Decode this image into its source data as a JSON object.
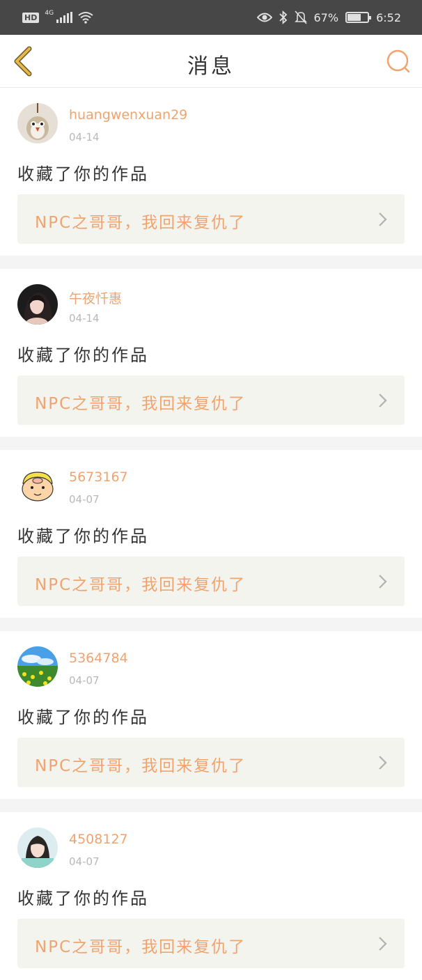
{
  "status_bar": {
    "hd": "HD",
    "network": "4G",
    "battery_text": "67%",
    "battery_level": 0.67,
    "time": "6:52"
  },
  "nav": {
    "title": "消息",
    "back_icon": "chevron-left-icon",
    "search_icon": "search-icon"
  },
  "colors": {
    "accent": "#f0a36e",
    "back_icon": "#e8b84a",
    "status_bg": "#474747"
  },
  "messages": [
    {
      "username": "huangwenxuan29",
      "date": "04-14",
      "action": "收藏了你的作品",
      "work_title": "NPC之哥哥，我回来复仇了",
      "avatar": "owl-avatar"
    },
    {
      "username": "午夜忏惠",
      "date": "04-14",
      "action": "收藏了你的作品",
      "work_title": "NPC之哥哥，我回来复仇了",
      "avatar": "portrait-avatar"
    },
    {
      "username": "5673167",
      "date": "04-07",
      "action": "收藏了你的作品",
      "work_title": "NPC之哥哥，我回来复仇了",
      "avatar": "pig-avatar"
    },
    {
      "username": "5364784",
      "date": "04-07",
      "action": "收藏了你的作品",
      "work_title": "NPC之哥哥，我回来复仇了",
      "avatar": "flower-field-avatar"
    },
    {
      "username": "4508127",
      "date": "04-07",
      "action": "收藏了你的作品",
      "work_title": "NPC之哥哥，我回来复仇了",
      "avatar": "girl-avatar"
    }
  ]
}
